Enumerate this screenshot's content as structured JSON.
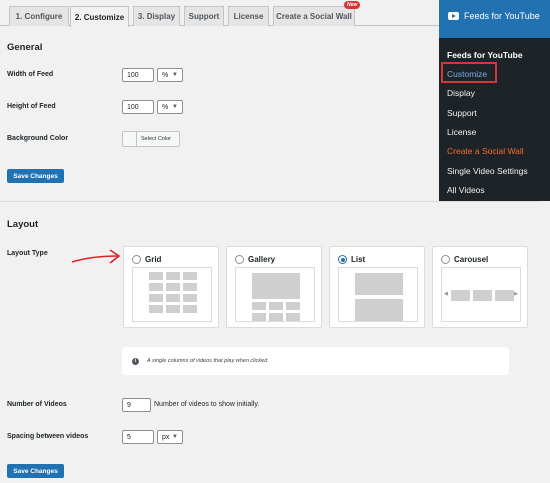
{
  "tabs": [
    {
      "label": "1. Configure",
      "active": false
    },
    {
      "label": "2. Customize",
      "active": true
    },
    {
      "label": "3. Display",
      "active": false
    },
    {
      "label": "Support",
      "active": false
    },
    {
      "label": "License",
      "active": false
    },
    {
      "label": "Create a Social Wall",
      "active": false
    }
  ],
  "new_badge": "New",
  "general": {
    "heading": "General",
    "width_label": "Width of Feed",
    "width_value": "100",
    "width_unit": "%",
    "height_label": "Height of Feed",
    "height_value": "100",
    "height_unit": "%",
    "bg_label": "Background Color",
    "bg_button": "Select Color",
    "save": "Save Changes"
  },
  "layout": {
    "heading": "Layout",
    "type_label": "Layout Type",
    "options": [
      {
        "label": "Grid",
        "selected": false
      },
      {
        "label": "Gallery",
        "selected": false
      },
      {
        "label": "List",
        "selected": true
      },
      {
        "label": "Carousel",
        "selected": false
      }
    ],
    "info_text": "A single columns of videos that play when clicked.",
    "num_videos_label": "Number of Videos",
    "num_videos_value": "9",
    "num_videos_help": "Number of videos to show initially.",
    "spacing_label": "Spacing between videos",
    "spacing_value": "5",
    "spacing_unit": "px",
    "save": "Save Changes"
  },
  "wp_menu": {
    "title": "Feeds for YouTube",
    "items": [
      {
        "label": "Feeds for YouTube",
        "kind": "heading"
      },
      {
        "label": "Customize",
        "kind": "current"
      },
      {
        "label": "Display",
        "kind": "normal"
      },
      {
        "label": "Support",
        "kind": "normal"
      },
      {
        "label": "License",
        "kind": "normal"
      },
      {
        "label": "Create a Social Wall",
        "kind": "social"
      },
      {
        "label": "Single Video Settings",
        "kind": "normal"
      },
      {
        "label": "All Videos",
        "kind": "normal"
      }
    ]
  },
  "colors": {
    "primary": "#2271b1",
    "menu_bg": "#1d2327",
    "highlight": "#d63638",
    "social": "#f56e28"
  },
  "icons": [
    "youtube-icon",
    "info-icon",
    "chevron-down-icon",
    "red-arrow-annotation"
  ]
}
